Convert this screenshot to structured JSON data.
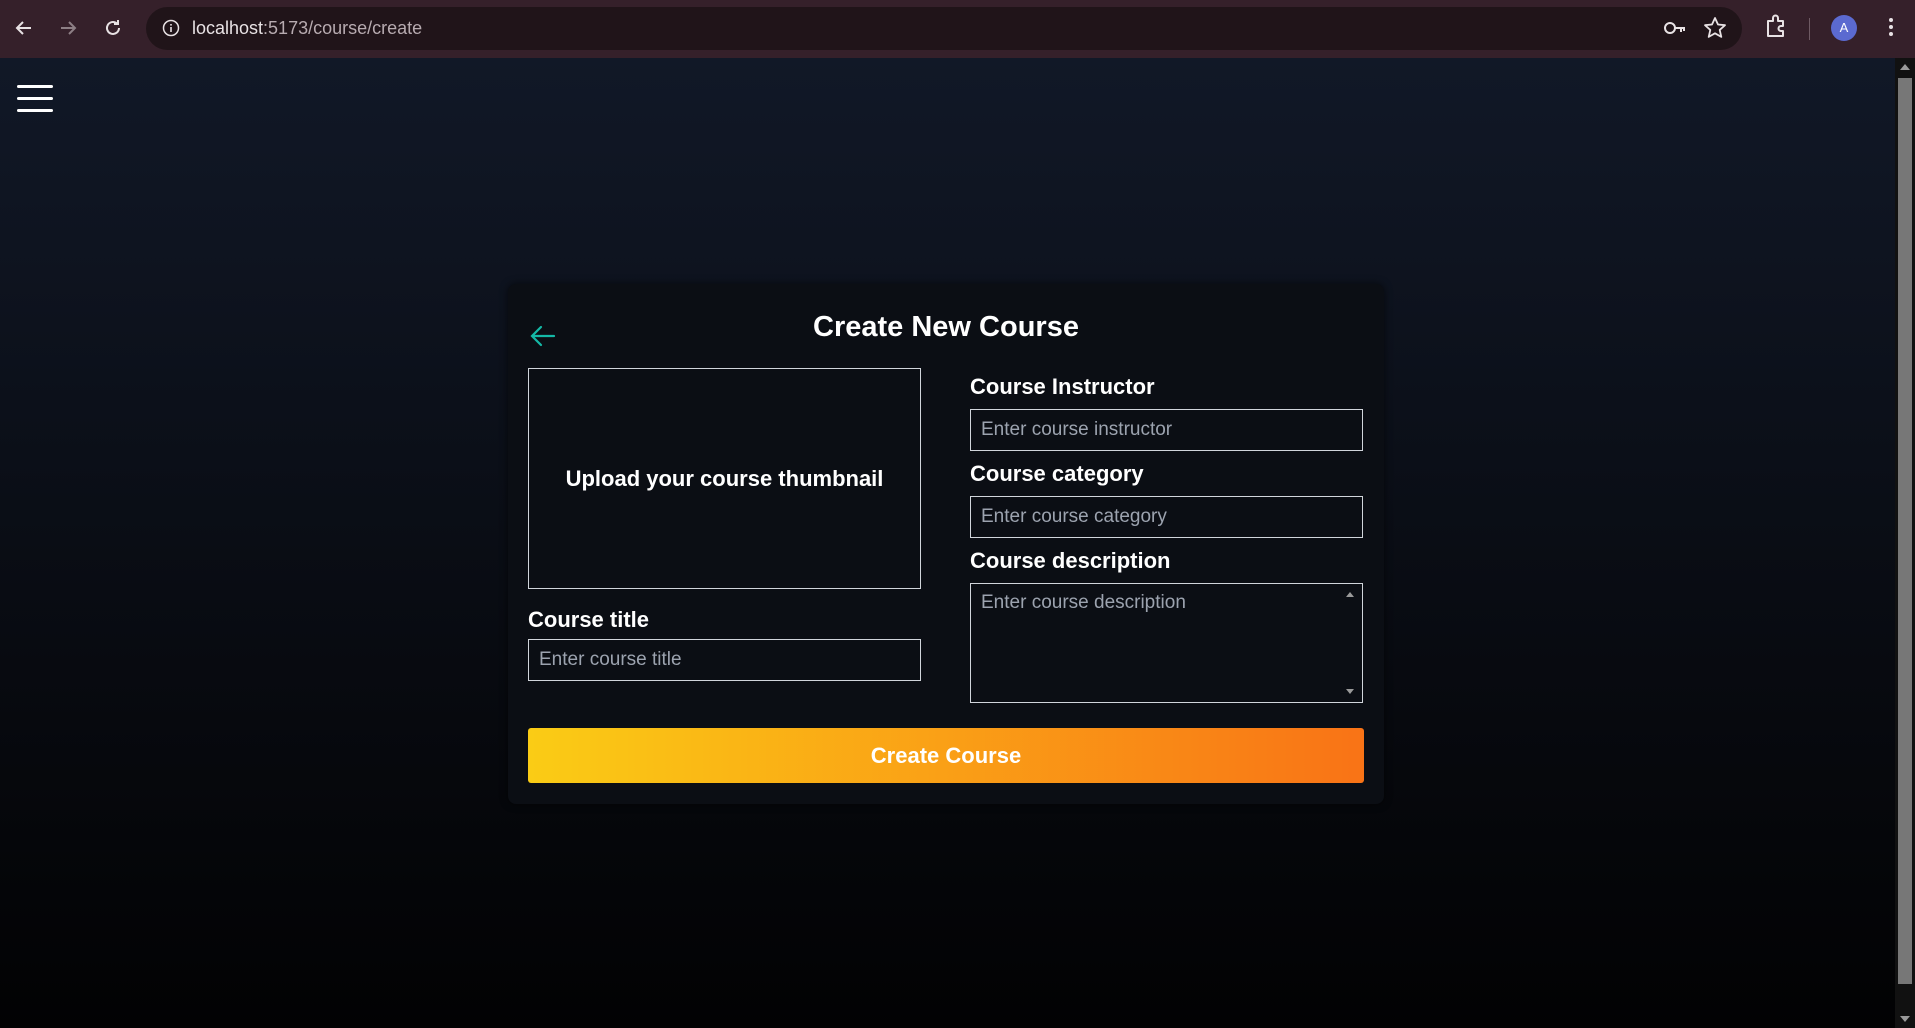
{
  "browser": {
    "url_host": "localhost",
    "url_path": ":5173/course/create"
  },
  "card": {
    "title": "Create New Course"
  },
  "thumbnail": {
    "label": "Upload your course thumbnail"
  },
  "fields": {
    "title_label": "Course title",
    "title_placeholder": "Enter course title",
    "instructor_label": "Course Instructor",
    "instructor_placeholder": "Enter course instructor",
    "category_label": "Course category",
    "category_placeholder": "Enter course category",
    "description_label": "Course description",
    "description_placeholder": "Enter course description"
  },
  "actions": {
    "create_label": "Create Course"
  },
  "profile": {
    "initial": "A"
  },
  "colors": {
    "accent_teal": "#14b8a6",
    "button_gradient_start": "#facc15",
    "button_gradient_end": "#f97316"
  }
}
